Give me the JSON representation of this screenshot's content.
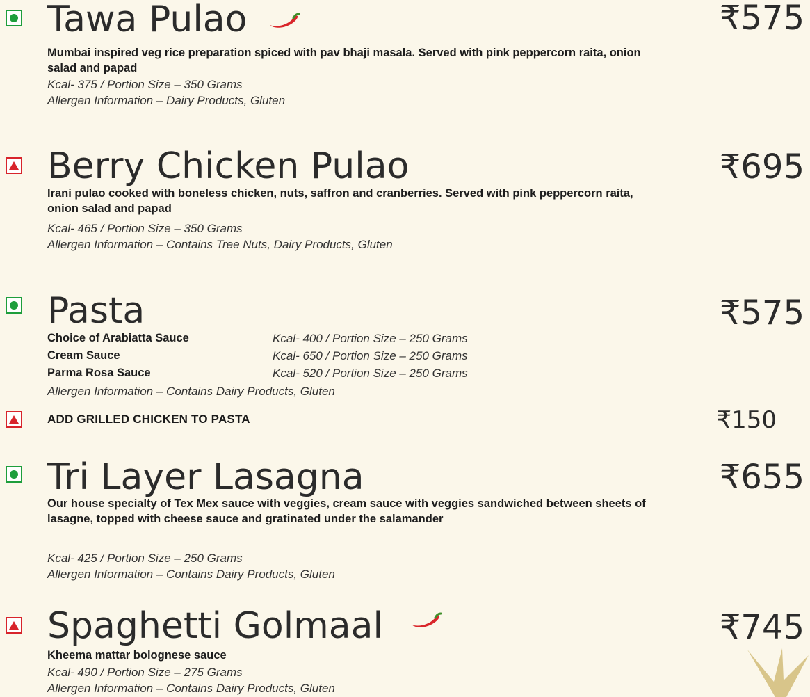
{
  "items": [
    {
      "title": "Tawa Pulao",
      "price": "₹575",
      "type": "veg",
      "spicy": true,
      "desc": "Mumbai inspired veg rice preparation spiced with pav bhaji masala. Served with pink peppercorn raita, onion salad and papad",
      "kcal": "Kcal- 375 / Portion Size – 350 Grams",
      "allergen": "Allergen Information – Dairy Products, Gluten"
    },
    {
      "title": "Berry Chicken Pulao",
      "price": "₹695",
      "type": "non-veg",
      "spicy": false,
      "desc": "Irani pulao cooked with boneless chicken, nuts, saffron and cranberries. Served with pink peppercorn raita, onion salad and papad",
      "kcal": "Kcal- 465 / Portion Size – 350 Grams",
      "allergen": "Allergen Information – Contains Tree Nuts, Dairy Products, Gluten"
    },
    {
      "title": "Pasta",
      "price": "₹575",
      "type": "veg",
      "spicy": false,
      "sauces": [
        {
          "name": "Choice of Arabiatta Sauce",
          "info": "Kcal- 400 / Portion Size – 250 Grams"
        },
        {
          "name": "Cream Sauce",
          "info": "Kcal- 650 / Portion Size – 250 Grams"
        },
        {
          "name": "Parma Rosa Sauce",
          "info": "Kcal- 520 / Portion Size – 250 Grams"
        }
      ],
      "allergen": "Allergen Information – Contains Dairy Products, Gluten"
    },
    {
      "title": "Tri Layer Lasagna",
      "price": "₹655",
      "type": "veg",
      "spicy": false,
      "desc": "Our house specialty of Tex Mex sauce with veggies, cream sauce with veggies sandwiched between sheets of lasagne, topped with cheese sauce and gratinated under the salamander",
      "kcal": "Kcal- 425 / Portion Size – 250 Grams",
      "allergen": "Allergen Information – Contains Dairy Products, Gluten"
    },
    {
      "title": "Spaghetti Golmaal",
      "price": "₹745",
      "type": "non-veg",
      "spicy": true,
      "desc": "Kheema mattar bolognese sauce",
      "kcal": "Kcal- 490 / Portion Size – 275 Grams",
      "allergen": "Allergen Information – Contains Dairy Products, Gluten"
    }
  ],
  "addon": {
    "label": "ADD GRILLED CHICKEN TO PASTA",
    "price": "₹150",
    "type": "non-veg"
  },
  "colors": {
    "veg": "#1e9e3c",
    "non_veg": "#d8242b",
    "background": "#fbf7ea",
    "chili": "#d9262b",
    "star": "#d8c58a"
  }
}
